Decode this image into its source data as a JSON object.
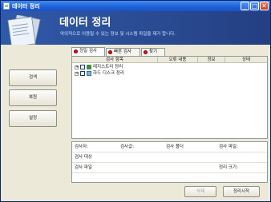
{
  "window": {
    "title": "데이터 정리"
  },
  "titlebar_buttons": {
    "minimize": "_",
    "maximize": "□",
    "close": "✕"
  },
  "header": {
    "title": "데이터 정리",
    "description": "악의적으로 이용될 수 있는 정보 및 시스템 파일을 제거 합니다."
  },
  "sidebar": {
    "items": [
      {
        "label": "검색"
      },
      {
        "label": "복원"
      },
      {
        "label": "설정"
      }
    ]
  },
  "tabs": [
    {
      "label": "정밀 검사"
    },
    {
      "label": "빠른 검사"
    },
    {
      "label": "찾기"
    }
  ],
  "grid": {
    "columns": [
      "검사 항목",
      "오류 내용",
      "정보",
      "상태"
    ],
    "rows": [
      {
        "expander": "+",
        "label": "레지스트리 정리"
      },
      {
        "expander": "+",
        "label": "하드 디스크 정리"
      }
    ]
  },
  "info": {
    "line1": {
      "a": "검사자:",
      "b": "검사값:",
      "c": "검사 폴더",
      "d": "검사 파일:"
    },
    "line2": {
      "a": "검사 대상"
    },
    "line3": {
      "a": "검사 파일",
      "b": "정리 크기:"
    }
  },
  "actions": {
    "delete_label": "삭제",
    "start_label": "정리시작"
  },
  "colors": {
    "titlebar": "#1f5fd6",
    "header": "#2c4f99",
    "background": "#ece9d8",
    "tab_dot": "#dd1111"
  }
}
